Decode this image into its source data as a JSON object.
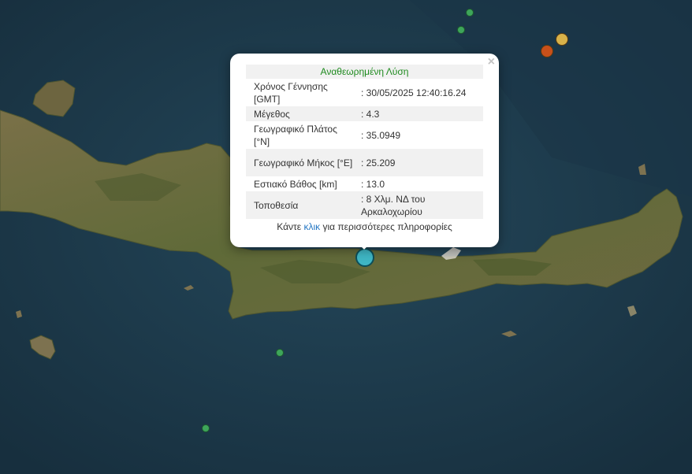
{
  "popup": {
    "title": "Αναθεωρημένη Λύση",
    "close_glyph": "×",
    "rows": [
      {
        "label": "Χρόνος Γέννησης [GMT]",
        "value": ": 30/05/2025 12:40:16.24"
      },
      {
        "label": "Μέγεθος",
        "value": ": 4.3"
      },
      {
        "label": "Γεωγραφικό Πλάτος [°N]",
        "value": ": 35.0949"
      },
      {
        "label": "Γεωγραφικό Μήκος [°E]",
        "value": ": 25.209"
      },
      {
        "label": "Εστιακό Βάθος [km]",
        "value": ": 13.0"
      },
      {
        "label": "Τοποθεσία",
        "value": ": 8 Χλμ. ΝΔ του Αρκαλοχωρίου"
      }
    ],
    "footer_prefix": "Κάντε",
    "footer_link": "κλικ",
    "footer_suffix": "για περισσότερες πληροφορίες"
  },
  "colors": {
    "sea": "#1d3a4c",
    "land": "#6f6a3c",
    "title_green": "#1e8a1e",
    "link_blue": "#2778c4",
    "quake_green": "#3ea55a",
    "quake_orange": "#c8501a",
    "quake_yellow": "#d8b24a",
    "quake_selected": "#3fb6c4"
  }
}
